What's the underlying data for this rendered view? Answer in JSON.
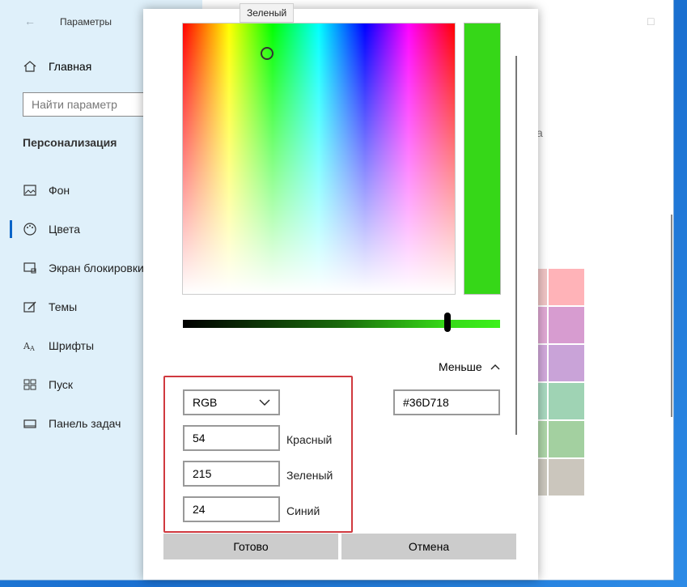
{
  "settings": {
    "title": "Параметры",
    "nav_home": "Главная",
    "search_placeholder": "Найти параметр",
    "section": "Персонализация",
    "nav": [
      {
        "label": "Фон"
      },
      {
        "label": "Цвета"
      },
      {
        "label": "Экран блокировки"
      },
      {
        "label": "Темы"
      },
      {
        "label": "Шрифты"
      },
      {
        "label": "Пуск"
      },
      {
        "label": "Панель задач"
      }
    ],
    "right_letter": "a",
    "swatches": [
      "#ffb3b8",
      "#d79cd0",
      "#c9a3d8",
      "#9fd3b4",
      "#a3d0a0",
      "#cbc6bd"
    ]
  },
  "picker": {
    "tooltip": "Зеленый",
    "current_color": "#36D718",
    "less_label": "Меньше",
    "hex_value": "#36D718",
    "mode": "RGB",
    "red_value": "54",
    "red_label": "Красный",
    "green_value": "215",
    "green_label": "Зеленый",
    "blue_value": "24",
    "blue_label": "Синий",
    "done_label": "Готово",
    "cancel_label": "Отмена"
  }
}
